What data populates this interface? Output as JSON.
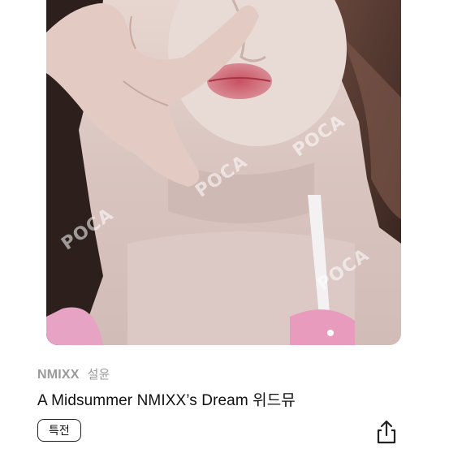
{
  "photo": {
    "image_icon": "portrait-photo",
    "watermark": "POCA"
  },
  "item": {
    "group": "NMIXX",
    "member": "설윤",
    "title": "A Midsummer NMIXX’s Dream 위드뮤",
    "badge": "특전"
  },
  "actions": {
    "share_icon": "share-icon"
  },
  "colors": {
    "meta_text": "#9a9a9a",
    "title_text": "#111111",
    "badge_border": "#222222"
  }
}
